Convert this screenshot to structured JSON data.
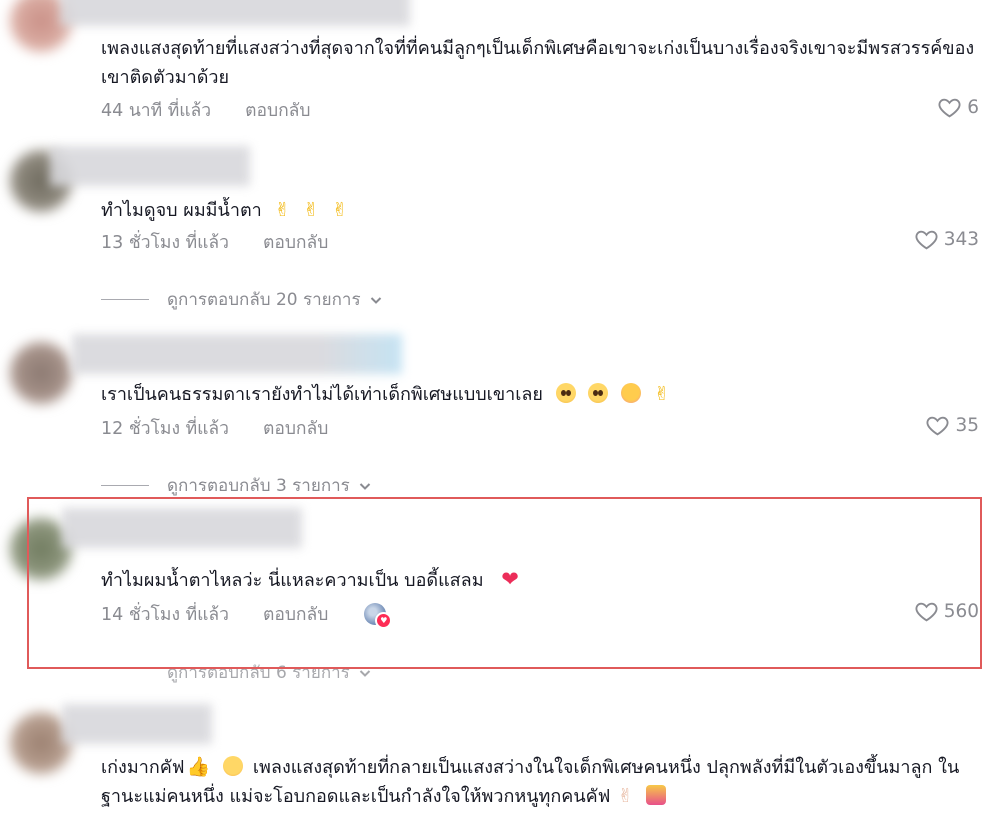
{
  "comments": [
    {
      "text": "เพลงแสงสุดท้ายที่แสงสว่างที่สุดจากใจที่ที่คนมีลูกๆเป็นเด็กพิเศษคือเขาจะเก่งเป็นบางเรื่องจริงเขาจะมีพรสวรรค์ของเขาติดตัวมาด้วย",
      "time": "44 นาที ที่แล้ว",
      "reply_label": "ตอบกลับ",
      "likes": "6"
    },
    {
      "text": "ทำไมดูจบ ผมมีน้ำตา",
      "time": "13 ชั่วโมง ที่แล้ว",
      "reply_label": "ตอบกลับ",
      "likes": "343",
      "view_replies": "ดูการตอบกลับ 20 รายการ"
    },
    {
      "text": "เราเป็นคนธรรมดาเรายังทำไม่ได้เท่าเด็กพิเศษแบบเขาเลย",
      "time": "12 ชั่วโมง ที่แล้ว",
      "reply_label": "ตอบกลับ",
      "likes": "35",
      "view_replies": "ดูการตอบกลับ 3 รายการ"
    },
    {
      "text": "ทำไมผมน้ำตาไหลว่ะ นี่แหละความเป็น บอดี้แสลม",
      "time": "14 ชั่วโมง ที่แล้ว",
      "reply_label": "ตอบกลับ",
      "likes": "560",
      "view_replies": "ดูการตอบกลับ 6 รายการ",
      "liked_by_creator": true
    },
    {
      "text_part1": "เก่งมากคัฟ",
      "text_part2": "เพลงแสงสุดท้ายที่กลายเป็นแสงสว่างในใจเด็กพิเศษคนหนึ่ง ปลุกพลังที่มีในตัวเองขึ้นมาลูก ในฐานะแม่คนหนึ่ง แม่จะโอบกอดและเป็นกำลังใจให้พวกหนูทุกคนคัฟ"
    }
  ],
  "icons": {
    "like": "heart-outline-icon",
    "chevron": "chevron-down-icon",
    "victory": "victory-hand-emoji",
    "creator_badge": "creator-avatar-badge"
  },
  "colors": {
    "text": "#161823",
    "meta": "#8a8b91",
    "highlight": "#e05a5a",
    "heart_emoji": "#ec2d59"
  }
}
